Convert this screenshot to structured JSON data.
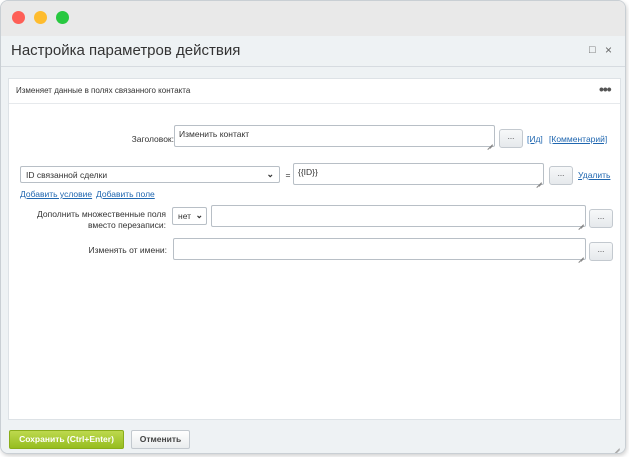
{
  "window": {
    "title": "Настройка параметров действия",
    "controls": {
      "maximize": "□",
      "close": "×"
    }
  },
  "panel": {
    "description": "Изменяет данные в полях связанного контакта",
    "more": "•••"
  },
  "form": {
    "title_label": "Заголовок:",
    "title_value": "Изменить контакт",
    "dots_label": "...",
    "id_link": "[Ид]",
    "comment_link": "[Комментарий]",
    "condition": {
      "field": "ID связанной сделки",
      "operator": "=",
      "value": "{{ID}}",
      "remove_link": "Удалить"
    },
    "add_condition_link": "Добавить условие",
    "add_field_link": "Добавить поле",
    "merge_label_line1": "Дополнить множественные поля",
    "merge_label_line2": "вместо перезаписи:",
    "merge_select": "нет",
    "merge_value": "",
    "run_as_label": "Изменять от имени:",
    "run_as_value": ""
  },
  "footer": {
    "save_label": "Сохранить (Ctrl+Enter)",
    "cancel_label": "Отменить"
  },
  "colors": {
    "save_button": "#96bd1f",
    "link": "#2067b0",
    "close_dot": "#fe5f57",
    "minimize_dot": "#febc2e",
    "zoom_dot": "#28c840"
  },
  "icons": [
    "chevron-down-icon",
    "more-icon",
    "resize-grip-icon",
    "maximize-icon",
    "close-icon"
  ]
}
